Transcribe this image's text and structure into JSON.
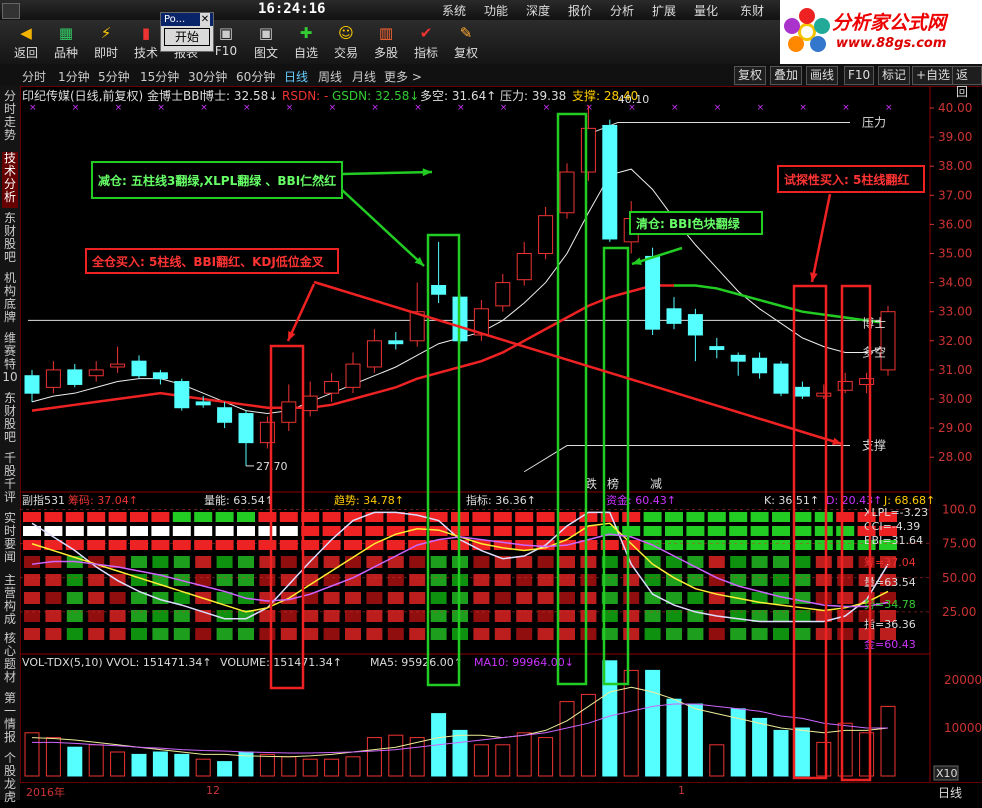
{
  "clock": "16:24:16",
  "top_menu": [
    "系统",
    "功能",
    "深度",
    "报价",
    "分析",
    "扩展",
    "量化",
    "东财"
  ],
  "toolbar": [
    {
      "label": "返回",
      "icon": "back-arrow-icon"
    },
    {
      "label": "品种",
      "icon": "grid-icon"
    },
    {
      "label": "即时",
      "icon": "lightning-icon"
    },
    {
      "label": "技术",
      "icon": "candle-icon"
    },
    {
      "label": "报表",
      "icon": "table-icon"
    },
    {
      "label": "F10",
      "icon": "f10-icon"
    },
    {
      "label": "图文",
      "icon": "f10-doc-icon"
    },
    {
      "label": "自选",
      "icon": "add-icon"
    },
    {
      "label": "交易",
      "icon": "person-icon"
    },
    {
      "label": "多股",
      "icon": "multi-icon"
    },
    {
      "label": "指标",
      "icon": "check-icon"
    },
    {
      "label": "复权",
      "icon": "pin-icon"
    }
  ],
  "popup": {
    "title": "Po...",
    "button": "开始"
  },
  "logo": {
    "text": "分析家公式网",
    "url": "www.88gs.com"
  },
  "periods": [
    "分时",
    "1分钟",
    "5分钟",
    "15分钟",
    "30分钟",
    "60分钟",
    "日线",
    "周线",
    "月线",
    "更多 >"
  ],
  "active_period": "日线",
  "right_buttons": [
    "复权",
    "叠加",
    "画线",
    "F10",
    "标记",
    "+自选",
    "返回"
  ],
  "left_tabs": [
    "分时走势",
    "技术分析",
    "东财股吧",
    "机构底牌",
    "维赛特10",
    "东财股吧",
    "千股千评",
    "实时要闻",
    "主营构成",
    "核心题材",
    "第一情报",
    "个股龙虎"
  ],
  "main_header": {
    "stock": "印纪传媒(日线,前复权) 金博士BBI",
    "bs": "博士: 32.58↓",
    "rsdn": "RSDN: -",
    "gsdn": "GSDN: 32.58↓",
    "dk": "多空: 31.64↑",
    "yl": "压力: 39.38",
    "zc": "支撑: 28.40"
  },
  "price_axis": [
    "40.00",
    "39.00",
    "38.00",
    "37.00",
    "36.00",
    "35.00",
    "34.00",
    "33.00",
    "32.00",
    "31.00",
    "30.00",
    "29.00",
    "28.00"
  ],
  "labels": {
    "high": "40.10",
    "low": "27.70",
    "pressure": "压力",
    "support": "支撑",
    "boshi": "博士",
    "duokong": "多空",
    "die": "跌",
    "bang": "榜",
    "jian": "减"
  },
  "annotations": {
    "reduce": "减仓: 五柱线3翻绿,XLPL翻绿 、BBI仁然红",
    "full": "全仓买入: 5柱线、BBI翻红、KDJ低位金叉",
    "clear": "清仓: BBI色块翻绿",
    "trial": "试探性买入: 5柱线翻红"
  },
  "sub1_header": {
    "name": "副指531",
    "cm": "筹码: 37.04↑",
    "ln": "量能: 63.54↑",
    "qs": "趋势: 34.78↑",
    "zb": "指标: 36.36↑",
    "zj": "资金: 60.43↑",
    "k": "K: 36.51↑",
    "d": "D: 20.43↑",
    "j": "J: 68.68↑"
  },
  "sub1_right": {
    "xlpl": "XLPL=-3.23",
    "cci": "CCI=-4.39",
    "bbi": "BBI=31.64",
    "chou": "筹=37.04",
    "liang": "量=63.54",
    "shi": "势=34.78",
    "zhi": "指=36.36",
    "jin": "金=60.43"
  },
  "sub1_axis": [
    "100.0",
    "75.00",
    "50.00",
    "25.00"
  ],
  "vol_header": {
    "name": "VOL-TDX(5,10)",
    "vvol": "VVOL: 151471.34↑",
    "volume": "VOLUME: 151471.34↑",
    "ma5": "MA5: 95926.00↑",
    "ma10": "MA10: 99964.00↓"
  },
  "vol_axis": [
    "20000",
    "10000"
  ],
  "vol_unit": "X10",
  "x_axis": [
    "2016年",
    "12",
    "1"
  ],
  "bottom_right": "日线",
  "chart_data": {
    "type": "candlestick",
    "ylim": [
      27.5,
      40.5
    ],
    "candles": [
      {
        "o": 30.8,
        "c": 30.2,
        "h": 31.0,
        "l": 29.9
      },
      {
        "o": 30.4,
        "c": 31.0,
        "h": 31.3,
        "l": 30.2
      },
      {
        "o": 31.0,
        "c": 30.5,
        "h": 31.2,
        "l": 30.4
      },
      {
        "o": 30.8,
        "c": 31.0,
        "h": 31.3,
        "l": 30.6
      },
      {
        "o": 31.1,
        "c": 31.2,
        "h": 31.8,
        "l": 30.9
      },
      {
        "o": 31.3,
        "c": 30.8,
        "h": 31.5,
        "l": 30.7
      },
      {
        "o": 30.9,
        "c": 30.7,
        "h": 31.0,
        "l": 30.5
      },
      {
        "o": 30.6,
        "c": 29.7,
        "h": 30.7,
        "l": 29.6
      },
      {
        "o": 29.9,
        "c": 29.8,
        "h": 30.1,
        "l": 29.7
      },
      {
        "o": 29.7,
        "c": 29.2,
        "h": 29.9,
        "l": 29.0
      },
      {
        "o": 29.5,
        "c": 28.5,
        "h": 29.6,
        "l": 27.7
      },
      {
        "o": 28.5,
        "c": 29.2,
        "h": 29.4,
        "l": 28.3
      },
      {
        "o": 29.2,
        "c": 29.9,
        "h": 30.5,
        "l": 28.9
      },
      {
        "o": 29.6,
        "c": 30.1,
        "h": 30.6,
        "l": 29.4
      },
      {
        "o": 30.2,
        "c": 30.6,
        "h": 30.9,
        "l": 29.9
      },
      {
        "o": 30.4,
        "c": 31.2,
        "h": 31.6,
        "l": 30.2
      },
      {
        "o": 31.1,
        "c": 32.0,
        "h": 32.4,
        "l": 30.9
      },
      {
        "o": 32.0,
        "c": 31.9,
        "h": 32.3,
        "l": 31.7
      },
      {
        "o": 32.0,
        "c": 33.0,
        "h": 34.0,
        "l": 31.8
      },
      {
        "o": 33.9,
        "c": 33.6,
        "h": 35.4,
        "l": 33.3
      },
      {
        "o": 33.5,
        "c": 32.0,
        "h": 33.6,
        "l": 31.9
      },
      {
        "o": 32.2,
        "c": 33.1,
        "h": 33.4,
        "l": 32.0
      },
      {
        "o": 33.2,
        "c": 34.0,
        "h": 34.3,
        "l": 33.0
      },
      {
        "o": 34.1,
        "c": 35.0,
        "h": 35.4,
        "l": 33.9
      },
      {
        "o": 35.0,
        "c": 36.3,
        "h": 36.6,
        "l": 34.8
      },
      {
        "o": 36.4,
        "c": 37.8,
        "h": 38.1,
        "l": 36.2
      },
      {
        "o": 37.8,
        "c": 39.3,
        "h": 40.1,
        "l": 37.5
      },
      {
        "o": 39.4,
        "c": 35.5,
        "h": 39.6,
        "l": 35.4
      },
      {
        "o": 35.4,
        "c": 36.2,
        "h": 36.8,
        "l": 35.0
      },
      {
        "o": 34.9,
        "c": 32.4,
        "h": 35.2,
        "l": 32.2
      },
      {
        "o": 33.1,
        "c": 32.6,
        "h": 33.5,
        "l": 32.4
      },
      {
        "o": 32.9,
        "c": 32.2,
        "h": 33.1,
        "l": 31.3
      },
      {
        "o": 31.8,
        "c": 31.7,
        "h": 32.1,
        "l": 31.4
      },
      {
        "o": 31.5,
        "c": 31.3,
        "h": 31.6,
        "l": 30.8
      },
      {
        "o": 31.4,
        "c": 30.9,
        "h": 31.6,
        "l": 30.7
      },
      {
        "o": 31.2,
        "c": 30.2,
        "h": 31.3,
        "l": 30.1
      },
      {
        "o": 30.4,
        "c": 30.1,
        "h": 30.6,
        "l": 30.0
      },
      {
        "o": 30.1,
        "c": 30.2,
        "h": 30.5,
        "l": 30.0
      },
      {
        "o": 30.3,
        "c": 30.6,
        "h": 30.9,
        "l": 30.2
      },
      {
        "o": 30.5,
        "c": 30.7,
        "h": 30.9,
        "l": 30.2
      },
      {
        "o": 31.0,
        "c": 33.0,
        "h": 33.2,
        "l": 30.8
      }
    ],
    "bbi_red": [
      29.6,
      29.7,
      29.8,
      29.9,
      30.0,
      30.1,
      30.2,
      30.1,
      30.0,
      29.9,
      29.8,
      29.7,
      29.7,
      29.7,
      29.8,
      30.0,
      30.2,
      30.4,
      30.7,
      30.9,
      31.1,
      31.3,
      31.6,
      32.0,
      32.4,
      32.8,
      33.2,
      33.5,
      33.7,
      33.9,
      33.9
    ],
    "bbi_green": [
      33.9,
      33.9,
      33.8,
      33.6,
      33.4,
      33.2,
      33.0,
      32.9,
      32.8,
      32.7,
      32.6
    ],
    "ma_white": [
      29.9,
      30.1,
      30.2,
      30.4,
      30.6,
      30.7,
      30.7,
      30.5,
      30.2,
      29.9,
      29.6,
      29.5,
      29.6,
      29.9,
      30.2,
      30.5,
      30.8,
      31.1,
      31.5,
      31.9,
      32.1,
      32.3,
      32.7,
      33.3,
      34.0,
      35.0,
      36.4,
      37.7,
      37.9,
      37.2,
      36.2,
      35.3,
      34.5,
      33.7,
      33.1,
      32.6,
      32.1,
      31.8,
      31.6,
      31.6,
      31.8
    ],
    "volumes": [
      9000,
      8000,
      6000,
      6500,
      5000,
      4500,
      5000,
      4500,
      3500,
      3000,
      5000,
      4500,
      4000,
      3500,
      3500,
      4000,
      8000,
      8500,
      8000,
      13000,
      9500,
      6500,
      6500,
      9000,
      8000,
      15500,
      17000,
      24000,
      22000,
      22000,
      16000,
      15000,
      6500,
      14000,
      12000,
      9500,
      10000,
      7000,
      11000,
      9000,
      14500
    ],
    "vol_up": [
      true,
      true,
      false,
      true,
      true,
      false,
      false,
      false,
      true,
      false,
      false,
      true,
      true,
      true,
      true,
      true,
      true,
      true,
      true,
      false,
      false,
      true,
      true,
      true,
      true,
      true,
      true,
      false,
      true,
      false,
      false,
      false,
      true,
      false,
      false,
      false,
      false,
      true,
      true,
      true,
      true
    ],
    "vol_ma5": [
      8000,
      7800,
      7500,
      7000,
      6500,
      6000,
      5500,
      5000,
      4500,
      4500,
      4200,
      4100,
      4000,
      4200,
      4500,
      5000,
      5500,
      6000,
      7000,
      8000,
      8500,
      8500,
      8000,
      8500,
      9500,
      11500,
      14500,
      17500,
      18500,
      17500,
      16000,
      14000,
      13000,
      12000,
      11000,
      10000,
      9500,
      9000,
      9500,
      9500,
      10000
    ],
    "vol_ma10": [
      7000,
      7000,
      6800,
      6500,
      6300,
      6000,
      5800,
      5500,
      5300,
      5200,
      5000,
      4900,
      4800,
      4800,
      4900,
      5000,
      5200,
      5500,
      6000,
      6500,
      7000,
      7500,
      8000,
      8500,
      9000,
      10000,
      11000,
      12500,
      13500,
      14500,
      15000,
      15000,
      14500,
      14000,
      13500,
      12500,
      12000,
      11000,
      10500,
      10000,
      10000
    ],
    "vol_ylim": [
      0,
      25000
    ],
    "kdj_k": [
      75,
      70,
      65,
      60,
      55,
      50,
      45,
      40,
      35,
      30,
      25,
      28,
      35,
      45,
      55,
      65,
      75,
      82,
      86,
      85,
      80,
      75,
      72,
      70,
      72,
      78,
      88,
      90,
      75,
      60,
      50,
      42,
      38,
      35,
      32,
      30,
      28,
      26,
      28,
      32,
      40
    ],
    "kdj_d": [
      60,
      62,
      62,
      60,
      58,
      55,
      52,
      48,
      44,
      40,
      35,
      33,
      34,
      38,
      44,
      50,
      58,
      66,
      74,
      78,
      80,
      78,
      76,
      74,
      73,
      74,
      78,
      82,
      80,
      74,
      66,
      58,
      50,
      44,
      40,
      36,
      33,
      30,
      29,
      29,
      32
    ],
    "kdj_j": [
      90,
      80,
      70,
      58,
      48,
      40,
      34,
      30,
      25,
      20,
      20,
      28,
      45,
      62,
      78,
      92,
      98,
      98,
      96,
      92,
      78,
      70,
      64,
      66,
      74,
      88,
      98,
      98,
      60,
      38,
      30,
      25,
      22,
      20,
      18,
      18,
      18,
      18,
      22,
      34,
      60
    ],
    "sub_ylim": [
      0,
      110
    ]
  }
}
